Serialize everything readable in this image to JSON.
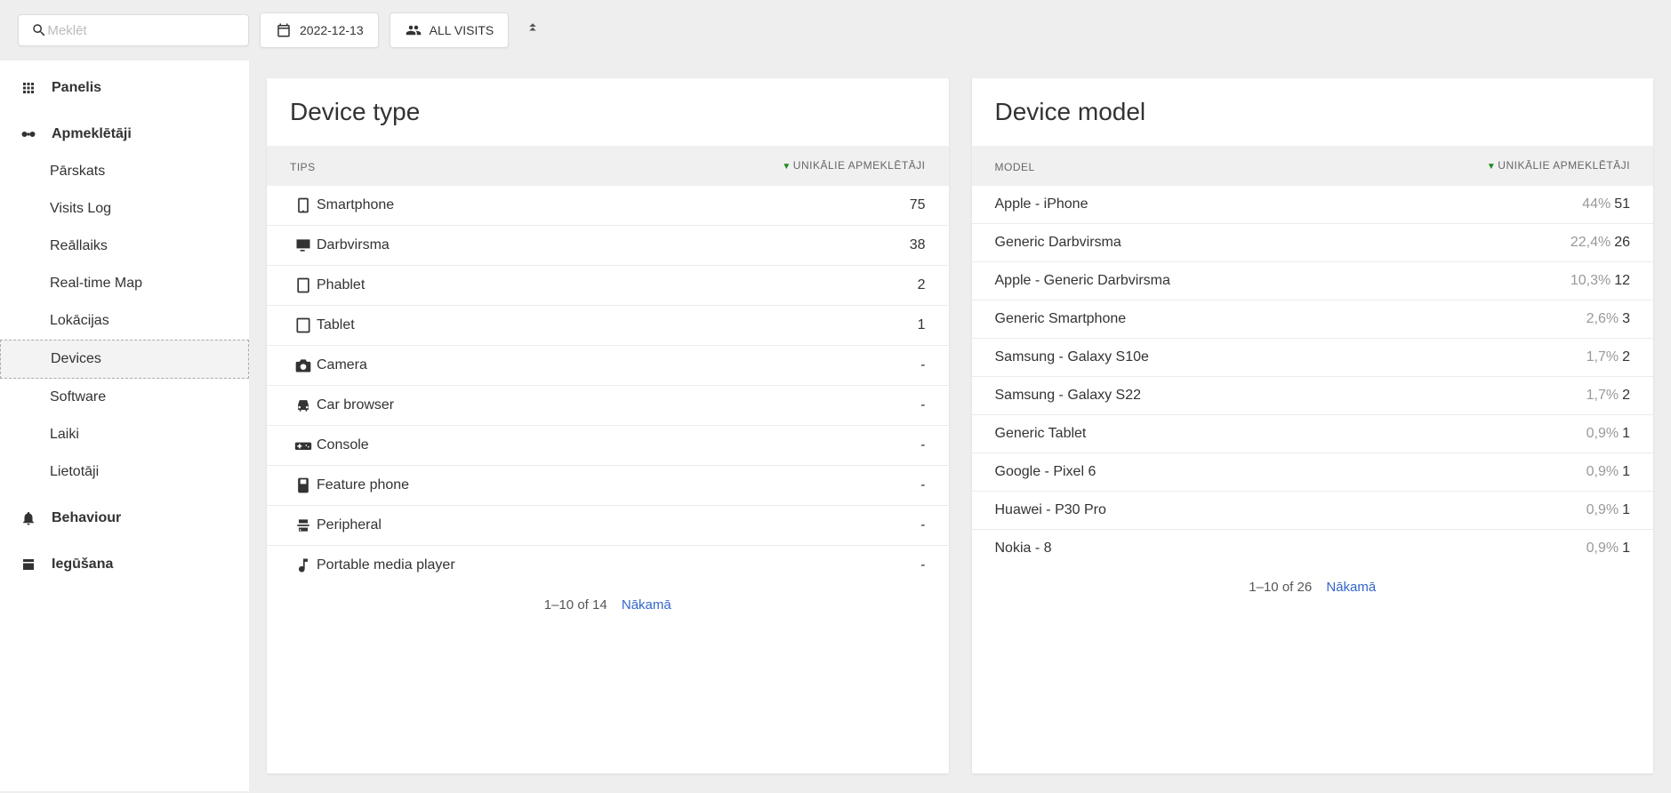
{
  "topbar": {
    "search_placeholder": "Meklēt",
    "date_label": "2022-12-13",
    "segment_label": "ALL VISITS"
  },
  "sidebar": {
    "panel_label": "Panelis",
    "visitors_label": "Apmeklētāji",
    "sub_items": [
      "Pārskats",
      "Visits Log",
      "Reāllaiks",
      "Real-time Map",
      "Lokācijas",
      "Devices",
      "Software",
      "Laiki",
      "Lietotāji"
    ],
    "behaviour_label": "Behaviour",
    "acquisition_label": "Iegūšana"
  },
  "cards": {
    "device_type": {
      "title": "Device type",
      "col_left": "TIPS",
      "col_right": "UNIKĀLIE APMEKLĒTĀJI",
      "rows": [
        {
          "icon": "smartphone",
          "label": "Smartphone",
          "value": "75"
        },
        {
          "icon": "desktop",
          "label": "Darbvirsma",
          "value": "38"
        },
        {
          "icon": "phablet",
          "label": "Phablet",
          "value": "2"
        },
        {
          "icon": "tablet",
          "label": "Tablet",
          "value": "1"
        },
        {
          "icon": "camera",
          "label": "Camera",
          "value": "-"
        },
        {
          "icon": "car",
          "label": "Car browser",
          "value": "-"
        },
        {
          "icon": "console",
          "label": "Console",
          "value": "-"
        },
        {
          "icon": "feature",
          "label": "Feature phone",
          "value": "-"
        },
        {
          "icon": "peripheral",
          "label": "Peripheral",
          "value": "-"
        },
        {
          "icon": "music",
          "label": "Portable media player",
          "value": "-"
        }
      ],
      "pagination_range": "1–10 of 14",
      "pagination_next": "Nākamā"
    },
    "device_model": {
      "title": "Device model",
      "col_left": "MODEL",
      "col_right": "UNIKĀLIE APMEKLĒTĀJI",
      "rows": [
        {
          "label": "Apple - iPhone",
          "pct": "44%",
          "value": "51"
        },
        {
          "label": "Generic Darbvirsma",
          "pct": "22,4%",
          "value": "26"
        },
        {
          "label": "Apple - Generic Darbvirsma",
          "pct": "10,3%",
          "value": "12"
        },
        {
          "label": "Generic Smartphone",
          "pct": "2,6%",
          "value": "3"
        },
        {
          "label": "Samsung - Galaxy S10e",
          "pct": "1,7%",
          "value": "2"
        },
        {
          "label": "Samsung - Galaxy S22",
          "pct": "1,7%",
          "value": "2"
        },
        {
          "label": "Generic Tablet",
          "pct": "0,9%",
          "value": "1"
        },
        {
          "label": "Google - Pixel 6",
          "pct": "0,9%",
          "value": "1"
        },
        {
          "label": "Huawei - P30 Pro",
          "pct": "0,9%",
          "value": "1"
        },
        {
          "label": "Nokia - 8",
          "pct": "0,9%",
          "value": "1"
        }
      ],
      "pagination_range": "1–10 of 26",
      "pagination_next": "Nākamā"
    }
  }
}
